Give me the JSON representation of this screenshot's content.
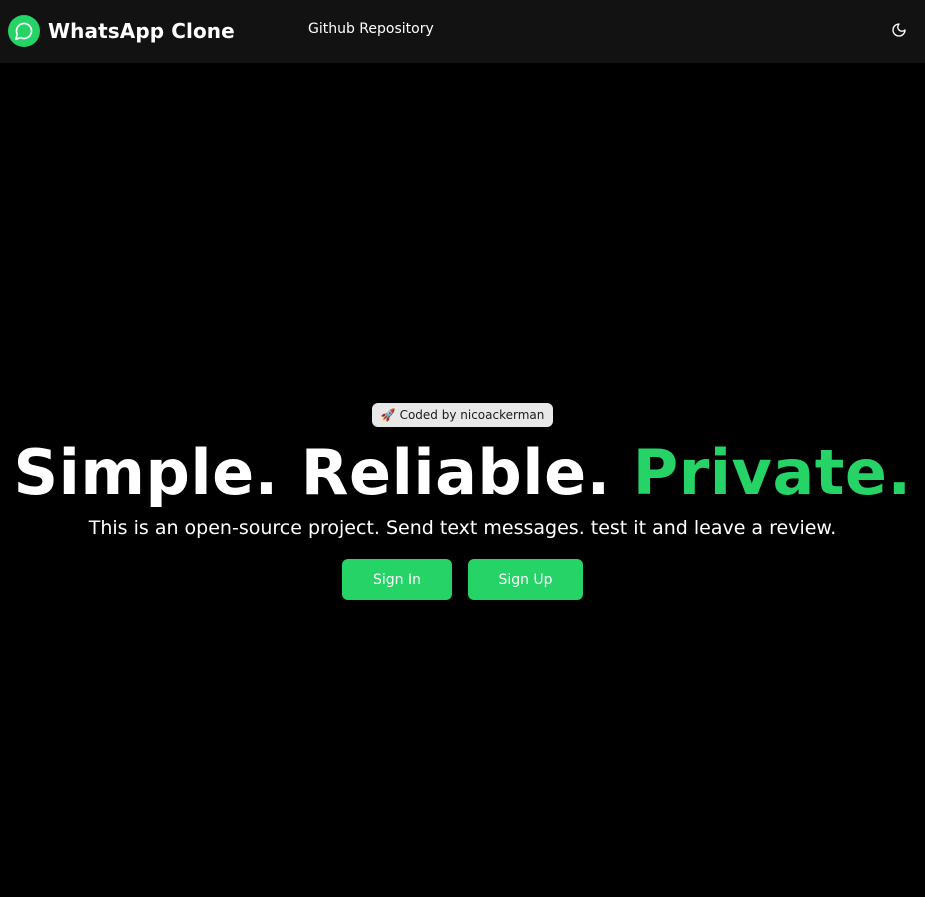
{
  "navbar": {
    "brand_name": "WhatsApp Clone",
    "brand_icon": "whatsapp-chat-icon",
    "links": [
      {
        "label": "Github Repository"
      }
    ],
    "theme_toggle_icon": "moon-icon"
  },
  "hero": {
    "badge": {
      "icon": "🚀",
      "text": "Coded by nicoackerman"
    },
    "headline": {
      "part1": "Simple. Reliable. ",
      "accent": "Private."
    },
    "subline": "This is an open-source project. Send text messages. test it and leave a review.",
    "buttons": {
      "sign_in": "Sign In",
      "sign_up": "Sign Up"
    }
  },
  "colors": {
    "accent": "#25d366",
    "background": "#000000",
    "navbar": "#121212",
    "badge_bg": "#e8e8e8"
  }
}
